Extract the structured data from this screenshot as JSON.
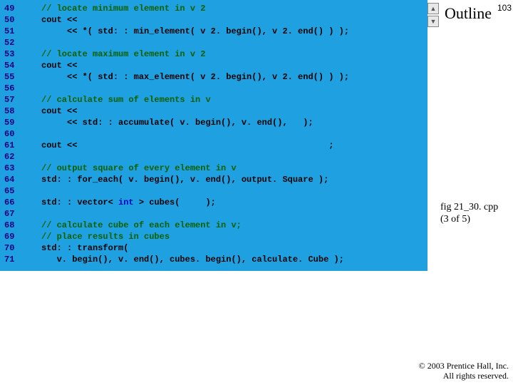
{
  "slide_number": "103",
  "outline_title": "Outline",
  "fig_label_line1": "fig 21_30. cpp",
  "fig_label_line2": "(3 of 5)",
  "copyright_line1": "© 2003 Prentice Hall, Inc.",
  "copyright_line2": "All rights reserved.",
  "nav_up": "▲",
  "nav_down": "▼",
  "code_lines": [
    {
      "n": "49",
      "segs": [
        {
          "cls": "comment",
          "t": "// locate minimum element in v 2"
        }
      ]
    },
    {
      "n": "50",
      "segs": [
        {
          "cls": "plain",
          "t": "cout << "
        }
      ]
    },
    {
      "n": "51",
      "segs": [
        {
          "cls": "plain",
          "t": "     << *( std: : min_element( v 2. begin(), v 2. end() ) );"
        }
      ]
    },
    {
      "n": "52",
      "segs": []
    },
    {
      "n": "53",
      "segs": [
        {
          "cls": "comment",
          "t": "// locate maximum element in v 2"
        }
      ]
    },
    {
      "n": "54",
      "segs": [
        {
          "cls": "plain",
          "t": "cout << "
        }
      ]
    },
    {
      "n": "55",
      "segs": [
        {
          "cls": "plain",
          "t": "     << *( std: : max_element( v 2. begin(), v 2. end() ) );"
        }
      ]
    },
    {
      "n": "56",
      "segs": []
    },
    {
      "n": "57",
      "segs": [
        {
          "cls": "comment",
          "t": "// calculate sum of elements in v"
        }
      ]
    },
    {
      "n": "58",
      "segs": [
        {
          "cls": "plain",
          "t": "cout << "
        }
      ]
    },
    {
      "n": "59",
      "segs": [
        {
          "cls": "plain",
          "t": "     << std: : accumulate( v. begin(), v. end(),   );"
        }
      ]
    },
    {
      "n": "60",
      "segs": []
    },
    {
      "n": "61",
      "segs": [
        {
          "cls": "plain",
          "t": "cout <<                                                 ;"
        }
      ]
    },
    {
      "n": "62",
      "segs": []
    },
    {
      "n": "63",
      "segs": [
        {
          "cls": "comment",
          "t": "// output square of every element in v"
        }
      ]
    },
    {
      "n": "64",
      "segs": [
        {
          "cls": "plain",
          "t": "std: : for_each( v. begin(), v. end(), output. Square );"
        }
      ]
    },
    {
      "n": "65",
      "segs": []
    },
    {
      "n": "66",
      "segs": [
        {
          "cls": "plain",
          "t": "std: : vector< "
        },
        {
          "cls": "kw-blue",
          "t": "int"
        },
        {
          "cls": "plain",
          "t": " > cubes(     );"
        }
      ]
    },
    {
      "n": "67",
      "segs": []
    },
    {
      "n": "68",
      "segs": [
        {
          "cls": "comment",
          "t": "// calculate cube of each element in v;"
        }
      ]
    },
    {
      "n": "69",
      "segs": [
        {
          "cls": "comment",
          "t": "// place results in cubes"
        }
      ]
    },
    {
      "n": "70",
      "segs": [
        {
          "cls": "plain",
          "t": "std: : transform("
        }
      ]
    },
    {
      "n": "71",
      "segs": [
        {
          "cls": "plain",
          "t": "   v. begin(), v. end(), cubes. begin(), calculate. Cube );"
        }
      ]
    }
  ]
}
